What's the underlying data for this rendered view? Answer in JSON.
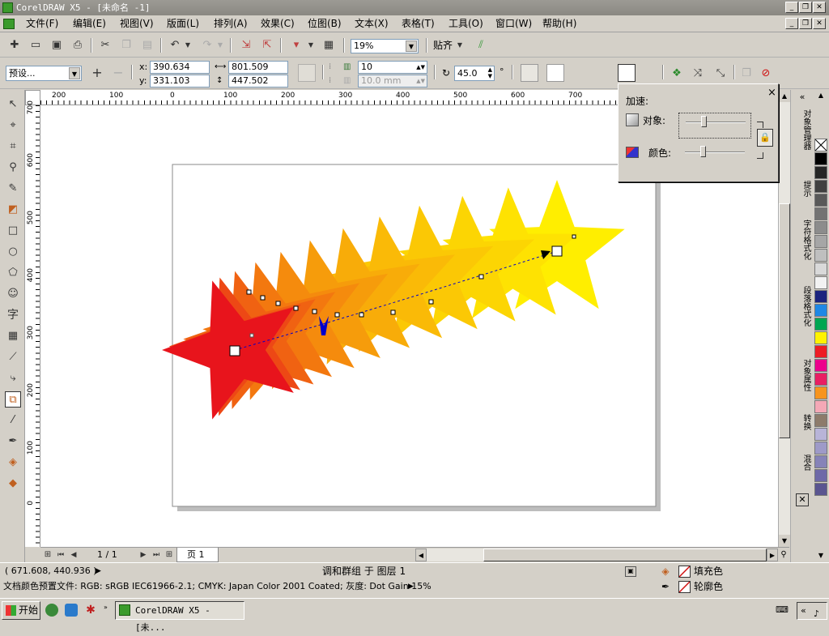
{
  "window": {
    "title": "CorelDRAW X5 - [未命名 -1]"
  },
  "menu": [
    "文件(F)",
    "编辑(E)",
    "视图(V)",
    "版面(L)",
    "排列(A)",
    "效果(C)",
    "位图(B)",
    "文本(X)",
    "表格(T)",
    "工具(O)",
    "窗口(W)",
    "帮助(H)"
  ],
  "toolbar": {
    "zoom_value": "19%",
    "snap_label": "贴齐"
  },
  "propbar": {
    "preset_value": "预设...",
    "x_label": "x:",
    "x_value": "390.634 mm",
    "y_label": "y:",
    "y_value": "331.103 mm",
    "w_value": "801.509 mm",
    "h_value": "447.502 mm",
    "steps_value": "10",
    "spacing_value": "10.0 mm",
    "rotation_value": "45.0",
    "degree_symbol": "°"
  },
  "ruler_top": [
    "200",
    "100",
    "0",
    "100",
    "200",
    "300",
    "400",
    "500",
    "600",
    "700"
  ],
  "ruler_left": [
    "700",
    "600",
    "500",
    "400",
    "300",
    "200",
    "100",
    "0"
  ],
  "accel_popup": {
    "title": "加速:",
    "object_label": "对象:",
    "object_value": 0.3,
    "color_label": "颜色:",
    "color_value": 0.3,
    "close_symbol": "×"
  },
  "docker_tabs": [
    "对象管理器",
    "提示",
    "字符格式化",
    "段落格式化",
    "对象属性",
    "转换",
    "混合"
  ],
  "palette": [
    "#ffffff",
    "#000000",
    "#262626",
    "#404040",
    "#595959",
    "#737373",
    "#8c8c8c",
    "#a6a6a6",
    "#bfbfbf",
    "#d9d9d9",
    "#f2f2f2",
    "#1a237e",
    "#1e88e5",
    "#00a651",
    "#fff200",
    "#ed1c24",
    "#ec008c",
    "#e91e63",
    "#f7941d",
    "#f4a8b6",
    "#8d7b6b",
    "#b8b4d8",
    "#9e9ac8",
    "#8683b8",
    "#6e69a8",
    "#5a5590"
  ],
  "pager": {
    "page_count": "1 / 1",
    "page_tab": "页 1"
  },
  "status": {
    "coords": "( 671.608, 440.936 )",
    "selection": "调和群组 于 图层 1",
    "fill_label": "填充色",
    "outline_label": "轮廓色",
    "profile": "文档颜色预置文件: RGB: sRGB IEC61966-2.1; CMYK: Japan Color 2001 Coated; 灰度: Dot Gain 15%"
  },
  "taskbar": {
    "start": "开始",
    "task": "CorelDRAW X5 - [未..."
  },
  "colors": {
    "star_red": "#e8141c",
    "star_yellow": "#ffee00",
    "accent_blue": "#0000cc"
  }
}
